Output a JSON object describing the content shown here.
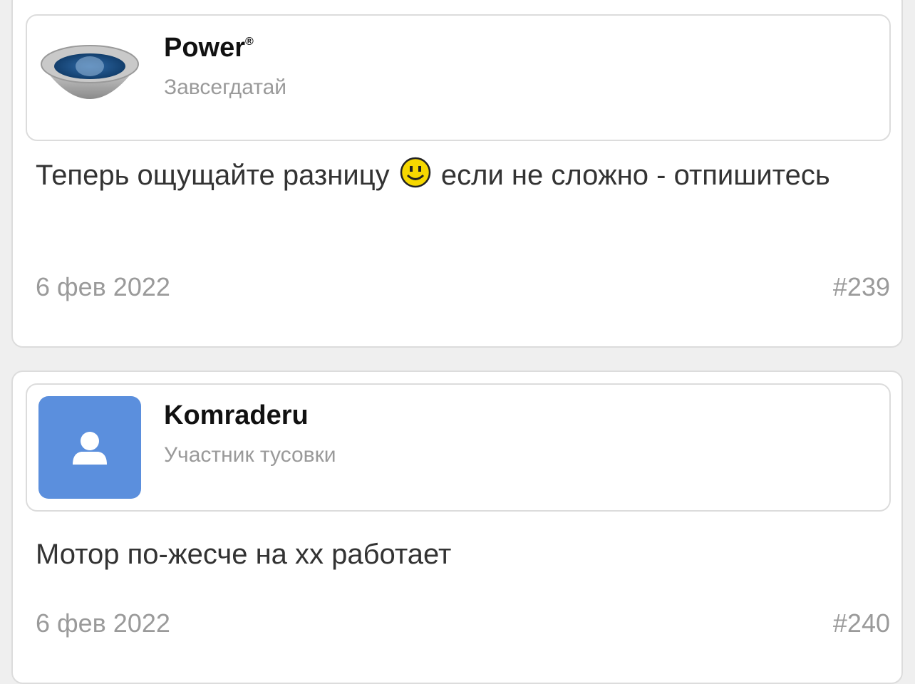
{
  "posts": [
    {
      "author": "Power",
      "author_mark": "®",
      "rank": "Завсегдатай",
      "avatar_icon": "steel-bowl-avatar-icon",
      "message_before": "Теперь ощущайте разницу",
      "message_emoji": "smiley-icon",
      "message_after": "если не сложно - отпишитесь",
      "date": "6 фев 2022",
      "number": "#239"
    },
    {
      "author": "Komraderu",
      "rank": "Участник тусовки",
      "avatar_icon": "default-user-avatar-icon",
      "avatar_color": "#5b8fdd",
      "message": "Мотор по-жесче на хх работает",
      "date": "6 фев 2022",
      "number": "#240"
    }
  ]
}
